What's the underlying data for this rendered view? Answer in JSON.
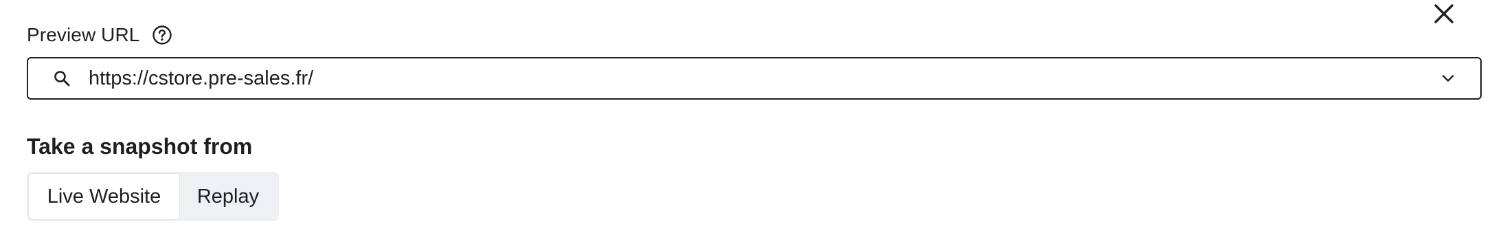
{
  "dialog": {
    "close_icon": "close-icon"
  },
  "preview_url": {
    "label": "Preview URL",
    "help_icon": "help-circle-icon",
    "search_icon": "search-icon",
    "value": "https://cstore.pre-sales.fr/",
    "dropdown_icon": "chevron-down-icon"
  },
  "snapshot": {
    "heading": "Take a snapshot from",
    "options": [
      {
        "label": "Live Website",
        "selected": true
      },
      {
        "label": "Replay",
        "selected": false
      }
    ]
  },
  "colors": {
    "text": "#1f1f23",
    "border": "#1f1f23",
    "segment_track": "#eef0f3",
    "segment_selected": "#ffffff"
  }
}
